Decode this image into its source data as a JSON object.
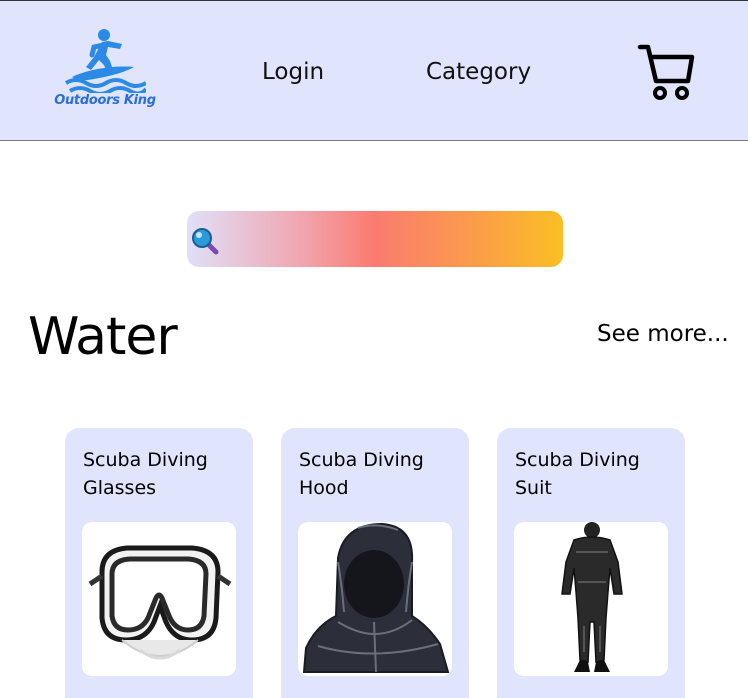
{
  "header": {
    "logo_text": "Outdoors King",
    "nav": {
      "login": "Login",
      "category": "Category"
    },
    "cart_icon": "shopping-cart-icon"
  },
  "search": {
    "placeholder": "",
    "icon": "magnifier-icon"
  },
  "section": {
    "title": "Water",
    "see_more": "See more..."
  },
  "products": [
    {
      "name": "Scuba Diving Glasses",
      "image": "diving-mask"
    },
    {
      "name": "Scuba Diving Hood",
      "image": "diving-hood"
    },
    {
      "name": "Scuba Diving Suit",
      "image": "diving-suit"
    }
  ],
  "colors": {
    "header_bg": "#e0e4fc",
    "card_bg": "#e0e4fc",
    "logo_blue": "#2b8ae6",
    "search_gradient": [
      "#e0e0f8",
      "#fa7b70",
      "#fbbf24"
    ]
  }
}
